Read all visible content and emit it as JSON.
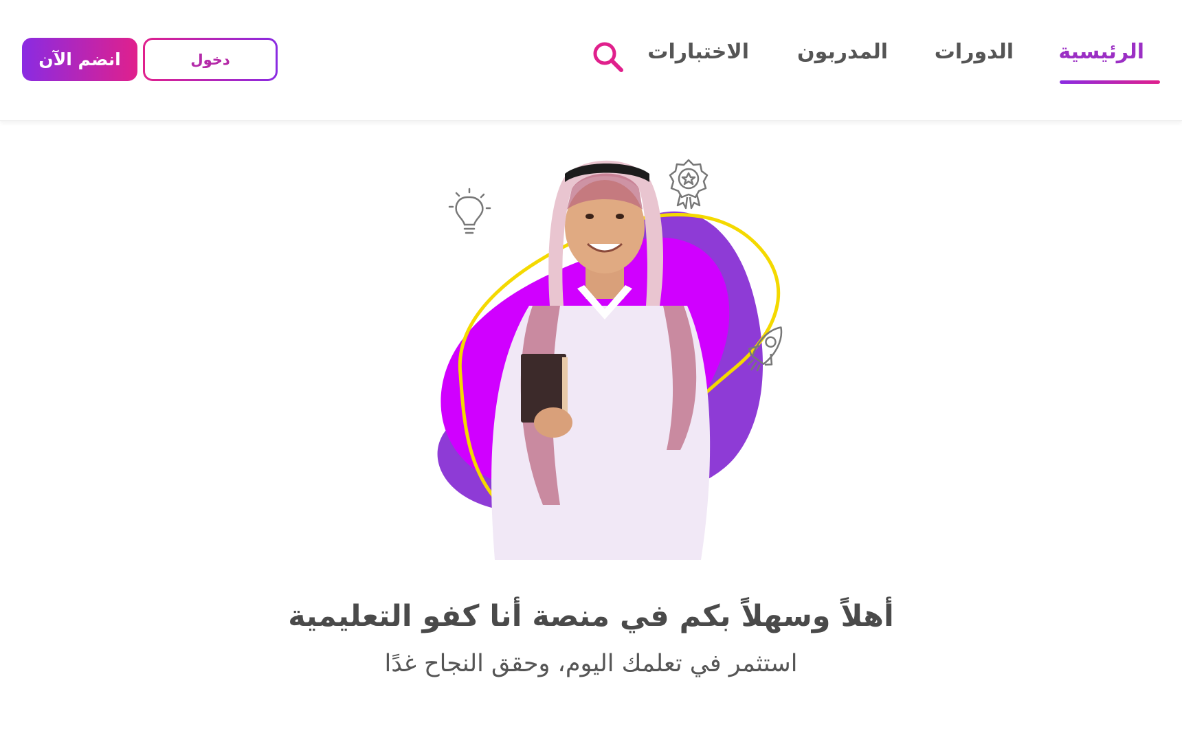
{
  "nav": {
    "items": [
      {
        "label": "الرئيسية",
        "active": true
      },
      {
        "label": "الدورات",
        "active": false
      },
      {
        "label": "المدربون",
        "active": false
      },
      {
        "label": "الاختبارات",
        "active": false
      }
    ],
    "search_icon": "search-icon"
  },
  "header": {
    "login_label": "دخول",
    "join_label": "انضم الآن"
  },
  "hero": {
    "title": "أهلاً وسهلاً بكم في منصة أنا كفو التعليمية",
    "subtitle": "استثمر في تعلمك اليوم، وحقق النجاح غدًا",
    "icons": [
      "lightbulb-icon",
      "award-badge-icon",
      "rocket-icon"
    ]
  },
  "colors": {
    "accent_purple": "#9b2fc4",
    "gradient_start": "#8a2be2",
    "gradient_end": "#e0208c",
    "search_pink": "#e0208c",
    "blob_magenta": "#d000ff",
    "blob_purple": "#8e3bd6",
    "ring_yellow": "#f4d900",
    "text_dark": "#4a4a4a"
  }
}
